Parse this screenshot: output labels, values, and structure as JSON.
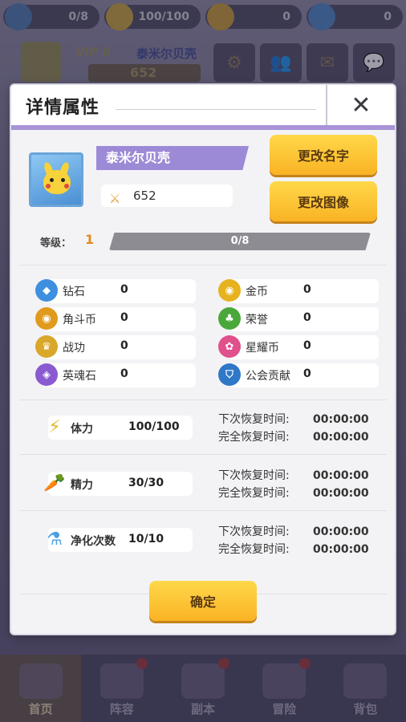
{
  "topbar": {
    "items": [
      {
        "icon": "level-icon",
        "value": "0/8"
      },
      {
        "icon": "stamina-icon",
        "value": "100/100"
      },
      {
        "icon": "gold-coin-icon",
        "value": "0"
      },
      {
        "icon": "diamond-icon",
        "value": "0"
      }
    ]
  },
  "profile": {
    "vip": "VIP 0",
    "name": "泰米尔贝壳",
    "power": "652"
  },
  "bottom_nav": {
    "items": [
      {
        "label": "首页"
      },
      {
        "label": "阵容"
      },
      {
        "label": "副本"
      },
      {
        "label": "冒险"
      },
      {
        "label": "背包"
      }
    ]
  },
  "dialog": {
    "title": "详情属性",
    "close": "✕",
    "name": "泰米尔贝壳",
    "power": "652",
    "rename_label": "更改名字",
    "change_avatar_label": "更改图像",
    "level_label": "等级：",
    "level": "1",
    "exp_text": "0/8",
    "exp_fraction": 0.0,
    "currencies": [
      {
        "name": "钻石",
        "value": "0",
        "icon": "diamond-icon",
        "color": "#3f8fe0"
      },
      {
        "name": "金币",
        "value": "0",
        "icon": "gold-coin-icon",
        "color": "#e6b21e"
      },
      {
        "name": "角斗币",
        "value": "0",
        "icon": "arena-coin-icon",
        "color": "#e09a1c"
      },
      {
        "name": "荣誉",
        "value": "0",
        "icon": "honor-icon",
        "color": "#4aa83a"
      },
      {
        "name": "战功",
        "value": "0",
        "icon": "merit-icon",
        "color": "#d9a82a"
      },
      {
        "name": "星耀币",
        "value": "0",
        "icon": "star-coin-icon",
        "color": "#e0508a"
      },
      {
        "name": "英魂石",
        "value": "0",
        "icon": "soul-stone-icon",
        "color": "#8a5ad0"
      },
      {
        "name": "公会贡献",
        "value": "0",
        "icon": "guild-contribution-icon",
        "color": "#2f78c8"
      }
    ],
    "stats": [
      {
        "name": "体力",
        "value": "100/100",
        "icon": "lightning-icon"
      },
      {
        "name": "精力",
        "value": "30/30",
        "icon": "carrot-icon"
      },
      {
        "name": "净化次数",
        "value": "10/10",
        "icon": "potion-icon"
      }
    ],
    "next_recover_label": "下次恢复时间:",
    "full_recover_label": "完全恢复时间:",
    "recover_time": "00:00:00",
    "confirm_label": "确定"
  }
}
